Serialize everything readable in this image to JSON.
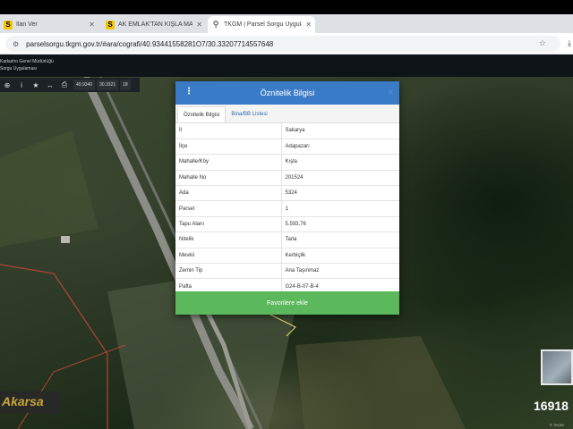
{
  "browser": {
    "tabs": [
      {
        "favicon": "S",
        "title": "İlan Ver"
      },
      {
        "favicon": "S",
        "title": "AK EMLAK'TAN KIŞLA MAH..."
      },
      {
        "favicon": "pin",
        "title": "TKGM | Parsel Sorgu Uygulama"
      }
    ],
    "url": "parselsorgu.tkgm.gov.tr/#ara/cografi/40.93441558281O7/30.33207714557648"
  },
  "app_header": {
    "line1": "Kadastro Genel Müdürlüğü",
    "line2": "Sorgu Uygulaması"
  },
  "map_toolbar": {
    "coord_x": "40.9340",
    "coord_y": "30.3321",
    "zoom": "18"
  },
  "dialog": {
    "title": "Öznitelik Bilgisi",
    "tabs": [
      "Öznitelik Bilgisi",
      "Bina/BB Listesi"
    ],
    "rows": [
      {
        "key": "İl",
        "value": "Sakarya"
      },
      {
        "key": "İlçe",
        "value": "Adapazarı"
      },
      {
        "key": "Mahalle/Köy",
        "value": "Kışla"
      },
      {
        "key": "Mahalle No",
        "value": "201524"
      },
      {
        "key": "Ada",
        "value": "5324"
      },
      {
        "key": "Parsel",
        "value": "1"
      },
      {
        "key": "Tapu Alanı",
        "value": "5.593,76"
      },
      {
        "key": "Nitelik",
        "value": "Tarla"
      },
      {
        "key": "Mevkii",
        "value": "Kerbiçlik"
      },
      {
        "key": "Zemin Tip",
        "value": "Ana Taşınmaz"
      },
      {
        "key": "Pafta",
        "value": "G24-B-07-B-4"
      }
    ],
    "favorite_button": "Favorilere ekle"
  },
  "map_overlay": {
    "watermark": "Akarsa",
    "scale_number": "16918",
    "credits": "© TKGM"
  },
  "icons": [
    "tune-icon",
    "star-icon",
    "download-icon",
    "kebab-menu-icon",
    "close-icon",
    "crosshair-icon",
    "info-icon",
    "bookmark-star-icon",
    "measure-icon",
    "print-icon"
  ]
}
